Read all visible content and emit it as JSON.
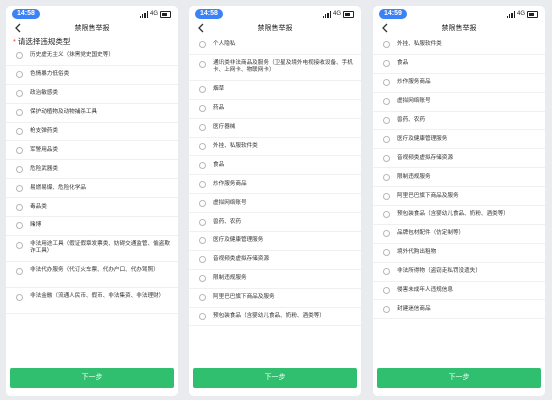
{
  "status": {
    "network": "4G"
  },
  "screens": [
    {
      "time": "14:58",
      "nav_title": "禁限售举报",
      "heading_star": "*",
      "heading": "请选择违规类型",
      "items": [
        "历史虚无主义（抹黑党史国史等）",
        "色情暴力低俗类",
        "政治敏感类",
        "保护动植物及动物捕杀工具",
        "枪支弹药类",
        "军警用品类",
        "危险武器类",
        "易燃易爆、危险化学品",
        "毒品类",
        "赌博",
        "非法用途工具（假证假章发票类、妨碍交通监管、偷盗欺诈工具）",
        "非法代办服务（代订火车票、代办户口、代办驾照）",
        "非法金融（流通人民币、假币、非法集资、非法理财）"
      ],
      "next_label": "下一步"
    },
    {
      "time": "14:58",
      "nav_title": "禁限售举报",
      "items": [
        "个人隐私",
        "通讯类非法商品及服务（卫星及境外电视接收设备、手机卡、上网卡、物联网卡）",
        "烟草",
        "药品",
        "医疗器械",
        "外挂、私服软件类",
        "食品",
        "炒作服务商品",
        "虚拟网络账号",
        "兽药、农药",
        "医疗及健康管理服务",
        "音视频类虚拟存储资源",
        "限制违规服务",
        "阿里巴巴旗下商品及服务",
        "预包装食品（含婴幼儿食品、奶粉、酒类等）"
      ],
      "next_label": "下一步"
    },
    {
      "time": "14:59",
      "nav_title": "禁限售举报",
      "items": [
        "外挂、私服软件类",
        "食品",
        "炒作服务商品",
        "虚拟网络账号",
        "兽药、农药",
        "医疗及健康管理服务",
        "音视频类虚拟存储资源",
        "限制违规服务",
        "阿里巴巴旗下商品及服务",
        "预包装食品（含婴幼儿食品、奶粉、酒类等）",
        "品牌包材配件（仿定制等）",
        "境外代购出租物",
        "非法所得物（盗窃走私罚没遗失）",
        "侵害未成年人违规信息",
        "封建迷信商品"
      ],
      "next_label": "下一步"
    }
  ]
}
